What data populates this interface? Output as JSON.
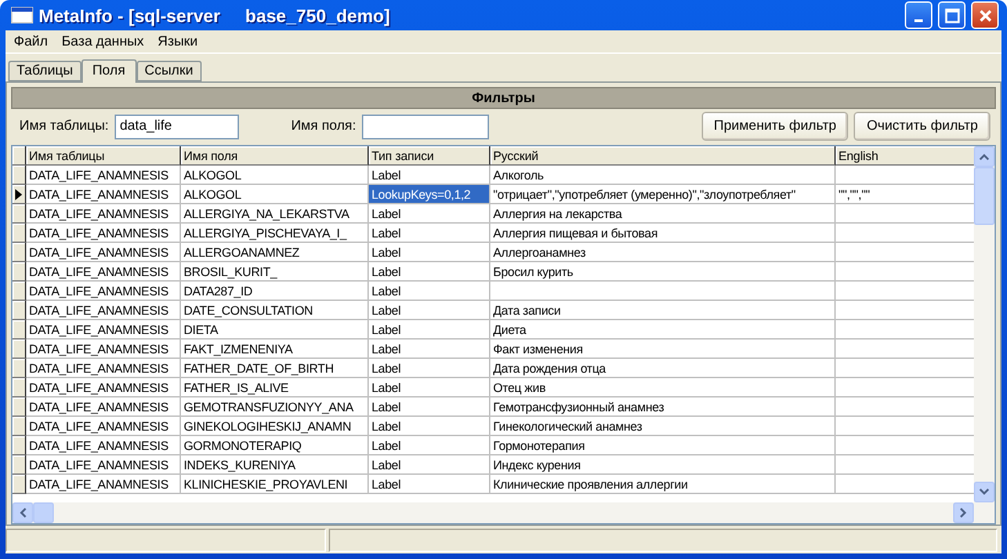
{
  "window": {
    "title": "MetaInfo - [sql-server     base_750_demo]"
  },
  "menu": [
    "Файл",
    "База данных",
    "Языки"
  ],
  "tabs": [
    {
      "label": "Таблицы",
      "selected": false
    },
    {
      "label": "Поля",
      "selected": true
    },
    {
      "label": "Ссылки",
      "selected": false
    }
  ],
  "filters": {
    "title": "Фильтры",
    "table_name": {
      "label": "Имя таблицы:",
      "value": "data_life"
    },
    "field_name": {
      "label": "Имя поля:"
    },
    "buttons": [
      "Применить фильтр",
      "Очистить фильтр"
    ]
  },
  "table": {
    "columns": [
      "Имя таблицы",
      "Имя поля",
      "Тип записи",
      "Русский",
      "English"
    ],
    "rows": [
      {
        "current": false,
        "cells": [
          {
            "text": "DATA_LIFE_ANAMNESIS",
            "selected": false
          },
          {
            "text": "ALKOGOL",
            "selected": false
          },
          {
            "text": "Label",
            "selected": false
          },
          {
            "text": "Алкоголь",
            "selected": false
          },
          {
            "text": "",
            "selected": false
          }
        ]
      },
      {
        "current": true,
        "cells": [
          {
            "text": "DATA_LIFE_ANAMNESIS",
            "selected": false
          },
          {
            "text": "ALKOGOL",
            "selected": false
          },
          {
            "text": "LookupKeys=0,1,2",
            "selected": true
          },
          {
            "text": "\"отрицает\",\"употребляет (умеренно)\",\"злоупотребляет\"",
            "selected": false
          },
          {
            "text": "\"\",\"\",\"\"",
            "selected": false
          }
        ]
      },
      {
        "current": false,
        "cells": [
          {
            "text": "DATA_LIFE_ANAMNESIS",
            "selected": false
          },
          {
            "text": "ALLERGIYA_NA_LEKARSTVA",
            "selected": false
          },
          {
            "text": "Label",
            "selected": false
          },
          {
            "text": "Аллергия на лекарства",
            "selected": false
          },
          {
            "text": "",
            "selected": false
          }
        ]
      },
      {
        "current": false,
        "cells": [
          {
            "text": "DATA_LIFE_ANAMNESIS",
            "selected": false
          },
          {
            "text": "ALLERGIYA_PISCHEVAYA_I_",
            "selected": false
          },
          {
            "text": "Label",
            "selected": false
          },
          {
            "text": "Аллергия пищевая и бытовая",
            "selected": false
          },
          {
            "text": "",
            "selected": false
          }
        ]
      },
      {
        "current": false,
        "cells": [
          {
            "text": "DATA_LIFE_ANAMNESIS",
            "selected": false
          },
          {
            "text": "ALLERGOANAMNEZ",
            "selected": false
          },
          {
            "text": "Label",
            "selected": false
          },
          {
            "text": "Аллергоанамнез",
            "selected": false
          },
          {
            "text": "",
            "selected": false
          }
        ]
      },
      {
        "current": false,
        "cells": [
          {
            "text": "DATA_LIFE_ANAMNESIS",
            "selected": false
          },
          {
            "text": "BROSIL_KURIT_",
            "selected": false
          },
          {
            "text": "Label",
            "selected": false
          },
          {
            "text": "Бросил курить",
            "selected": false
          },
          {
            "text": "",
            "selected": false
          }
        ]
      },
      {
        "current": false,
        "cells": [
          {
            "text": "DATA_LIFE_ANAMNESIS",
            "selected": false
          },
          {
            "text": "DATA287_ID",
            "selected": false
          },
          {
            "text": "Label",
            "selected": false
          },
          {
            "text": "",
            "selected": false
          },
          {
            "text": "",
            "selected": false
          }
        ]
      },
      {
        "current": false,
        "cells": [
          {
            "text": "DATA_LIFE_ANAMNESIS",
            "selected": false
          },
          {
            "text": "DATE_CONSULTATION",
            "selected": false
          },
          {
            "text": "Label",
            "selected": false
          },
          {
            "text": "Дата записи",
            "selected": false
          },
          {
            "text": "",
            "selected": false
          }
        ]
      },
      {
        "current": false,
        "cells": [
          {
            "text": "DATA_LIFE_ANAMNESIS",
            "selected": false
          },
          {
            "text": "DIETA",
            "selected": false
          },
          {
            "text": "Label",
            "selected": false
          },
          {
            "text": "Диета",
            "selected": false
          },
          {
            "text": "",
            "selected": false
          }
        ]
      },
      {
        "current": false,
        "cells": [
          {
            "text": "DATA_LIFE_ANAMNESIS",
            "selected": false
          },
          {
            "text": "FAKT_IZMENENIYA",
            "selected": false
          },
          {
            "text": "Label",
            "selected": false
          },
          {
            "text": "Факт изменения",
            "selected": false
          },
          {
            "text": "",
            "selected": false
          }
        ]
      },
      {
        "current": false,
        "cells": [
          {
            "text": "DATA_LIFE_ANAMNESIS",
            "selected": false
          },
          {
            "text": "FATHER_DATE_OF_BIRTH",
            "selected": false
          },
          {
            "text": "Label",
            "selected": false
          },
          {
            "text": "Дата рождения отца",
            "selected": false
          },
          {
            "text": "",
            "selected": false
          }
        ]
      },
      {
        "current": false,
        "cells": [
          {
            "text": "DATA_LIFE_ANAMNESIS",
            "selected": false
          },
          {
            "text": "FATHER_IS_ALIVE",
            "selected": false
          },
          {
            "text": "Label",
            "selected": false
          },
          {
            "text": "Отец жив",
            "selected": false
          },
          {
            "text": "",
            "selected": false
          }
        ]
      },
      {
        "current": false,
        "cells": [
          {
            "text": "DATA_LIFE_ANAMNESIS",
            "selected": false
          },
          {
            "text": "GEMOTRANSFUZIONYY_ANA",
            "selected": false
          },
          {
            "text": "Label",
            "selected": false
          },
          {
            "text": "Гемотрансфузионный анамнез",
            "selected": false
          },
          {
            "text": "",
            "selected": false
          }
        ]
      },
      {
        "current": false,
        "cells": [
          {
            "text": "DATA_LIFE_ANAMNESIS",
            "selected": false
          },
          {
            "text": "GINEKOLOGIHESKIJ_ANAMN",
            "selected": false
          },
          {
            "text": "Label",
            "selected": false
          },
          {
            "text": "Гинекологический анамнез",
            "selected": false
          },
          {
            "text": "",
            "selected": false
          }
        ]
      },
      {
        "current": false,
        "cells": [
          {
            "text": "DATA_LIFE_ANAMNESIS",
            "selected": false
          },
          {
            "text": "GORMONOTERAPIQ",
            "selected": false
          },
          {
            "text": "Label",
            "selected": false
          },
          {
            "text": "Гормонотерапия",
            "selected": false
          },
          {
            "text": "",
            "selected": false
          }
        ]
      },
      {
        "current": false,
        "cells": [
          {
            "text": "DATA_LIFE_ANAMNESIS",
            "selected": false
          },
          {
            "text": "INDEKS_KURENIYA",
            "selected": false
          },
          {
            "text": "Label",
            "selected": false
          },
          {
            "text": "Индекс курения",
            "selected": false
          },
          {
            "text": "",
            "selected": false
          }
        ]
      },
      {
        "current": false,
        "cells": [
          {
            "text": "DATA_LIFE_ANAMNESIS",
            "selected": false
          },
          {
            "text": "KLINICHESKIE_PROYAVLENI",
            "selected": false
          },
          {
            "text": "Label",
            "selected": false
          },
          {
            "text": "Клинические проявления аллергии",
            "selected": false
          },
          {
            "text": "",
            "selected": false
          }
        ]
      }
    ]
  }
}
